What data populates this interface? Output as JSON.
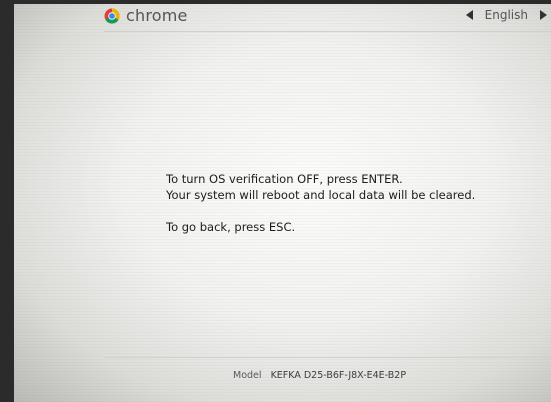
{
  "header": {
    "brand": "chrome",
    "language": "English"
  },
  "message": {
    "line1": "To turn OS verification OFF, press ENTER.",
    "line2": "Your system will reboot and local data will be cleared.",
    "line3": "To go back, press ESC."
  },
  "footer": {
    "model_label": "Model",
    "model_value": "KEFKA D25-B6F-J8X-E4E-B2P"
  },
  "colors": {
    "screen_bg": "#f4f4f2",
    "text": "#1c1c1c",
    "chrome_red": "#db4437",
    "chrome_green": "#0f9d58",
    "chrome_yellow": "#f4b400",
    "chrome_blue": "#4285f4"
  }
}
